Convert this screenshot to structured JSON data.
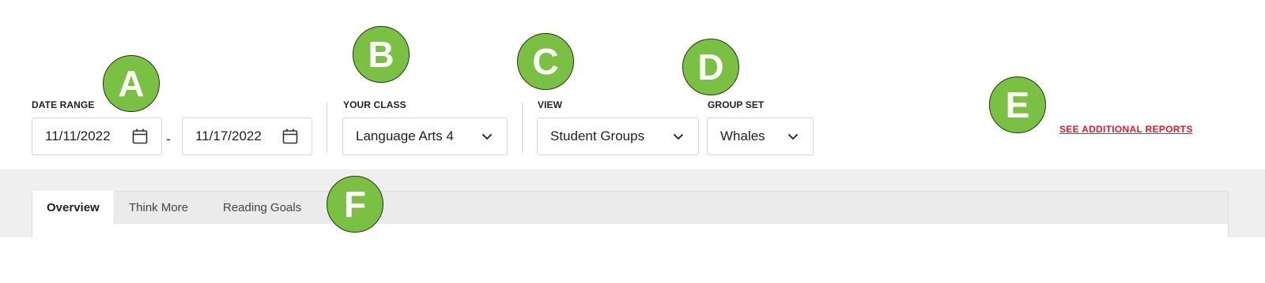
{
  "date_range": {
    "label": "DATE RANGE",
    "start": "11/11/2022",
    "separator": "-",
    "end": "11/17/2022"
  },
  "your_class": {
    "label": "YOUR CLASS",
    "selected": "Language Arts 4"
  },
  "view": {
    "label": "VIEW",
    "selected": "Student Groups"
  },
  "group_set": {
    "label": "GROUP SET",
    "selected": "Whales"
  },
  "additional_reports_link": "SEE ADDITIONAL REPORTS",
  "tabs": [
    {
      "label": "Overview",
      "active": true
    },
    {
      "label": "Think More",
      "active": false
    },
    {
      "label": "Reading Goals",
      "active": false
    }
  ],
  "markers": [
    "A",
    "B",
    "C",
    "D",
    "E",
    "F"
  ],
  "colors": {
    "marker_fill": "#7ac143",
    "link": "#e21a2a",
    "tab_band": "#efefef"
  },
  "icons": {
    "date": "calendar-icon",
    "dropdown": "chevron-down-icon"
  }
}
